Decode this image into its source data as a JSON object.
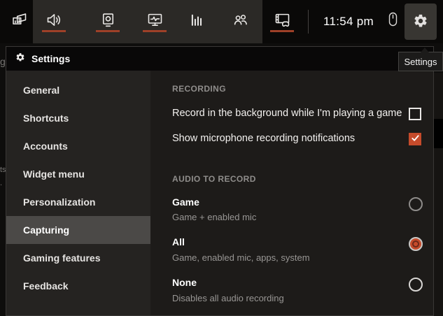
{
  "colors": {
    "accent": "#c54b2b",
    "widget_underline": "#9e4028",
    "selected_sidebar_bg": "#4b4947"
  },
  "toolbar": {
    "time": "11:54 pm",
    "icons": [
      {
        "name": "widget-menu-icon",
        "active": false
      },
      {
        "name": "audio-icon",
        "active": true
      },
      {
        "name": "capture-icon",
        "active": true
      },
      {
        "name": "performance-icon",
        "active": true
      },
      {
        "name": "resources-icon",
        "active": false
      },
      {
        "name": "looking-for-group-icon",
        "active": false
      },
      {
        "name": "gallery-icon",
        "active": true
      },
      {
        "name": "mouse-icon",
        "active": false
      },
      {
        "name": "gear-icon",
        "active": false
      }
    ]
  },
  "settings_window": {
    "title": "Settings",
    "tooltip": "Settings",
    "sidebar": [
      "General",
      "Shortcuts",
      "Accounts",
      "Widget menu",
      "Personalization",
      "Capturing",
      "Gaming features",
      "Feedback"
    ],
    "selected_item": "Capturing",
    "recording": {
      "heading": "RECORDING",
      "toggles": [
        {
          "label": "Record in the background while I'm playing a game",
          "checked": false
        },
        {
          "label": "Show microphone recording notifications",
          "checked": true
        }
      ]
    },
    "audio_to_record": {
      "heading": "AUDIO TO RECORD",
      "options": [
        {
          "label": "Game",
          "description": "Game + enabled mic",
          "selected": false
        },
        {
          "label": "All",
          "description": "Game, enabled mic, apps, system",
          "selected": true
        },
        {
          "label": "None",
          "description": "Disables all audio recording",
          "selected": false
        }
      ]
    }
  },
  "background_fragments": [
    "g",
    "ts",
    "."
  ]
}
